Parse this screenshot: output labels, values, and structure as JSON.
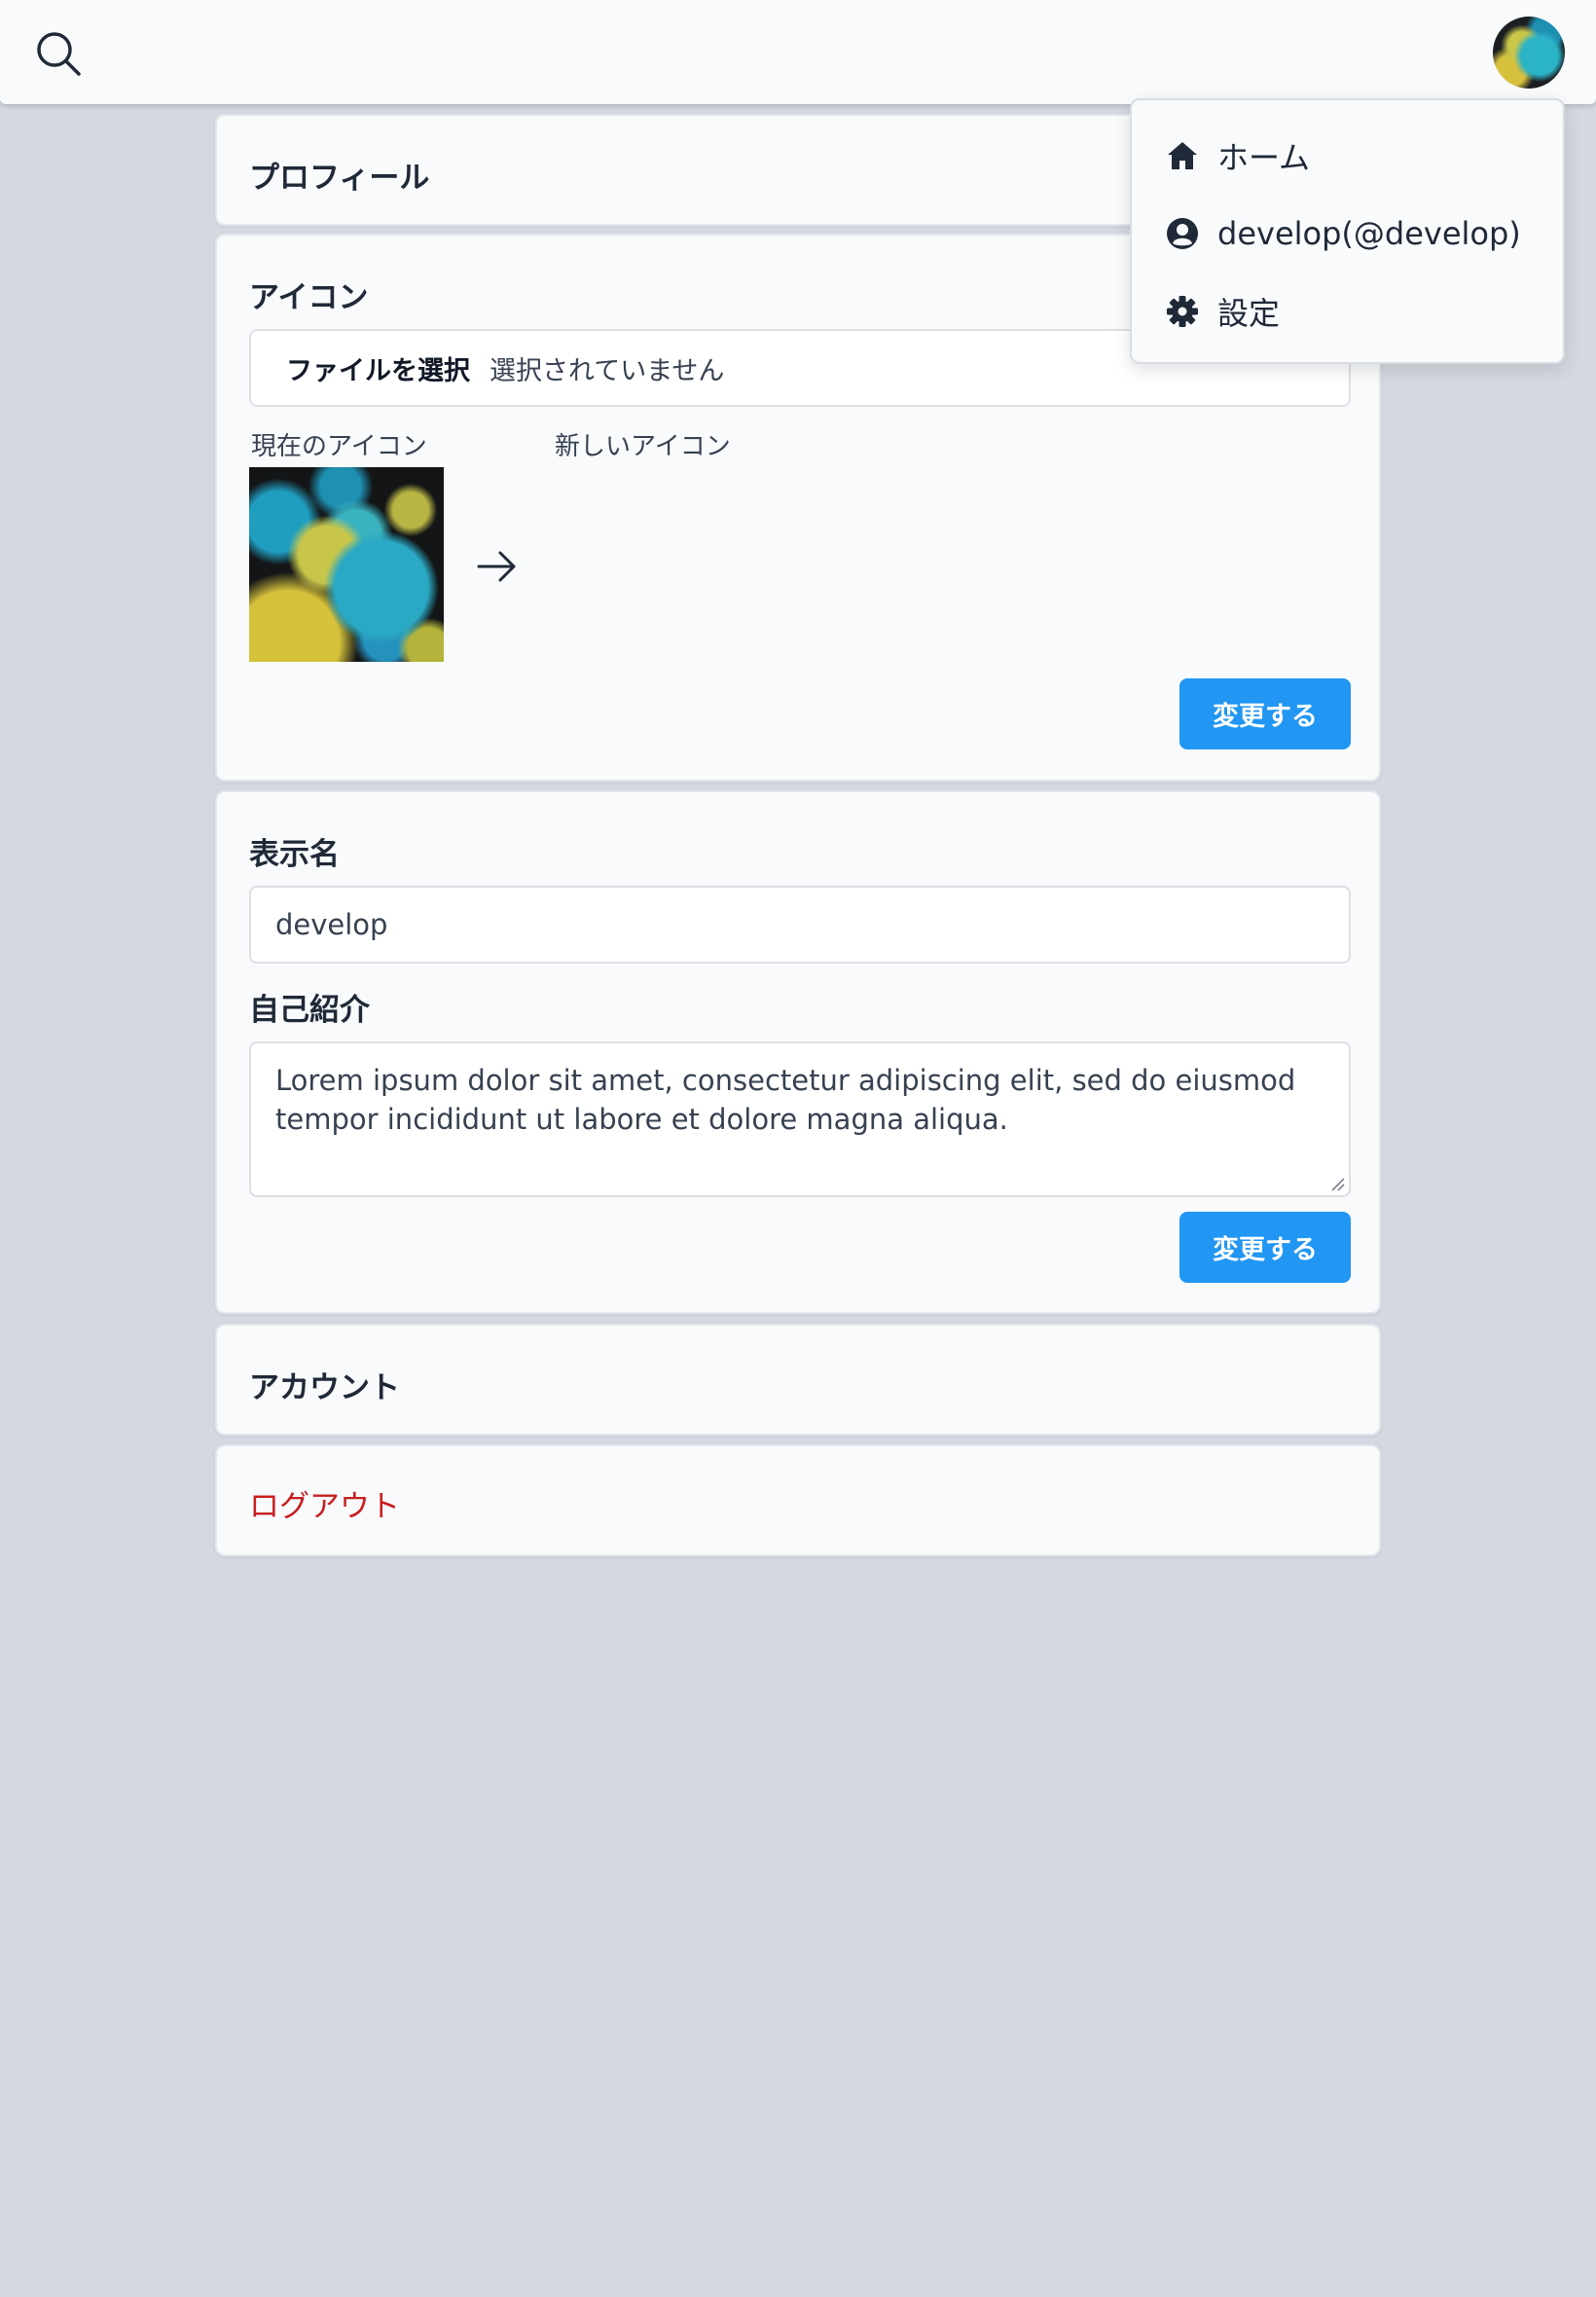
{
  "header": {
    "search_icon": "search-icon",
    "avatar_label": "user-avatar"
  },
  "dropdown": {
    "items": [
      {
        "label": "ホーム",
        "icon": "home-icon"
      },
      {
        "label": "develop(@develop)",
        "icon": "user-circle-icon"
      },
      {
        "label": "設定",
        "icon": "gear-icon"
      }
    ]
  },
  "profile_section": {
    "title": "プロフィール"
  },
  "icon_section": {
    "title": "アイコン",
    "file_button": "ファイルを選択",
    "file_status": "選択されていません",
    "current_label": "現在のアイコン",
    "new_label": "新しいアイコン",
    "submit": "変更する"
  },
  "profile_form": {
    "display_name_label": "表示名",
    "display_name_value": "develop",
    "bio_label": "自己紹介",
    "bio_value": "Lorem ipsum dolor sit amet, consectetur adipiscing elit, sed do eiusmod tempor incididunt ut labore et dolore magna aliqua.",
    "submit": "変更する"
  },
  "account_section": {
    "title": "アカウント"
  },
  "logout": {
    "label": "ログアウト"
  },
  "colors": {
    "background": "#d4d8e0",
    "card": "#f8fafc",
    "primary": "#2196f3",
    "danger": "#c81e1e"
  }
}
